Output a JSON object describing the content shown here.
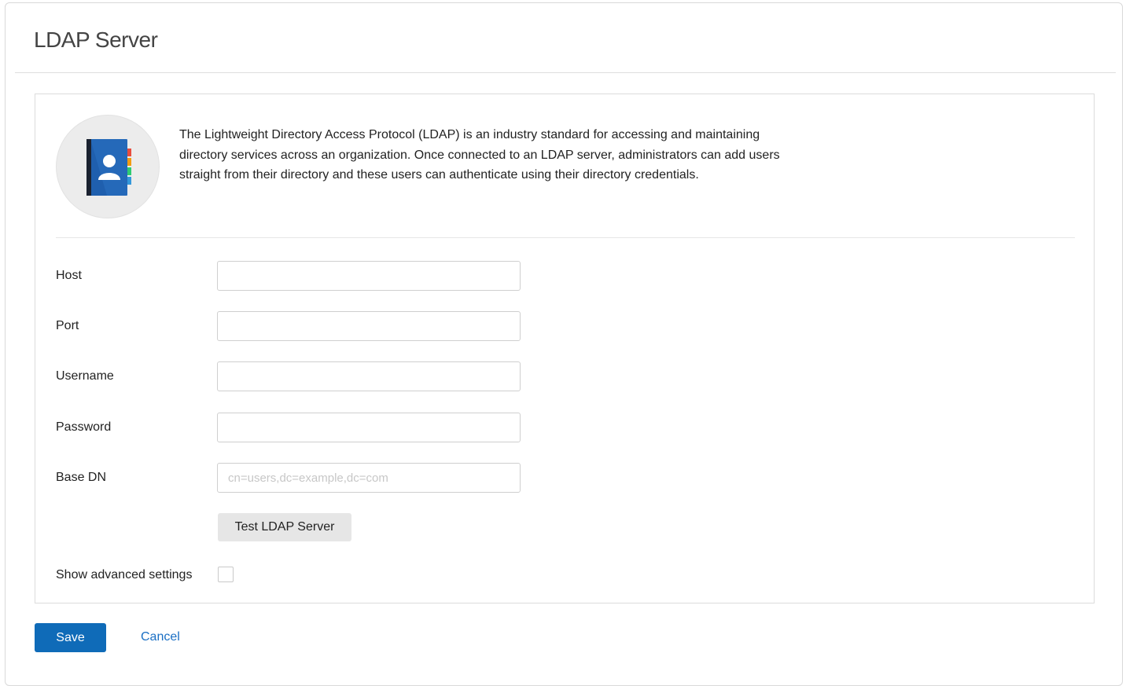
{
  "header": {
    "title": "LDAP Server"
  },
  "intro": {
    "icon": "address-book-icon",
    "description": "The Lightweight Directory Access Protocol (LDAP) is an industry standard for accessing and maintaining directory services across an organization. Once connected to an LDAP server, administrators can add users straight from their directory and these users can authenticate using their directory credentials."
  },
  "form": {
    "host": {
      "label": "Host",
      "value": "",
      "placeholder": ""
    },
    "port": {
      "label": "Port",
      "value": "",
      "placeholder": ""
    },
    "username": {
      "label": "Username",
      "value": "",
      "placeholder": ""
    },
    "password": {
      "label": "Password",
      "value": "",
      "placeholder": ""
    },
    "base_dn": {
      "label": "Base DN",
      "value": "",
      "placeholder": "cn=users,dc=example,dc=com"
    },
    "test_button_label": "Test LDAP Server",
    "advanced": {
      "label": "Show advanced settings",
      "checked": false
    }
  },
  "actions": {
    "save_label": "Save",
    "cancel_label": "Cancel"
  },
  "colors": {
    "primary": "#0f6bb8",
    "link": "#1a6fc4",
    "book_cover": "#1f5fae",
    "book_spine": "#2b2f3a",
    "tabs": [
      "#e84c3d",
      "#f39c12",
      "#f1c40f",
      "#2ecc71",
      "#3498db"
    ]
  }
}
